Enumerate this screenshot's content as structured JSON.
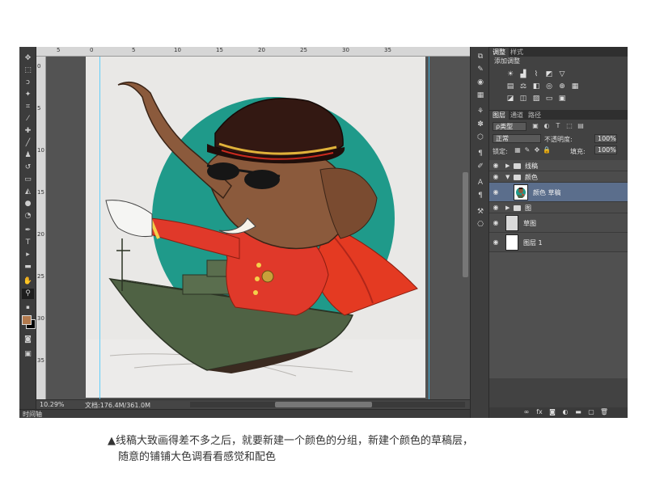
{
  "top_ruler_labels": [
    "5",
    "0",
    "5",
    "10",
    "15",
    "20",
    "25",
    "30",
    "35"
  ],
  "left_ruler_labels": [
    "0",
    "5",
    "10",
    "15",
    "20",
    "25",
    "30",
    "35"
  ],
  "status": {
    "zoom": "10.29%",
    "doc_size": "文档:176.4M/361.0M",
    "timeline_label": "时间轴"
  },
  "adjustments_panel": {
    "tabs": [
      "调整",
      "样式"
    ],
    "title": "添加调整"
  },
  "layers_panel": {
    "tabs": [
      "图层",
      "通道",
      "路径"
    ],
    "filter_kind": "ρ类型",
    "blend_mode": "正常",
    "opacity_label": "不透明度:",
    "opacity_value": "100%",
    "lock_label": "锁定:",
    "fill_label": "填充:",
    "fill_value": "100%",
    "layers": [
      {
        "name": "线稿",
        "type": "group",
        "expanded": false
      },
      {
        "name": "颜色",
        "type": "group",
        "expanded": true
      },
      {
        "name": "颜色 草稿",
        "type": "layer",
        "selected": true
      },
      {
        "name": "图",
        "type": "group",
        "expanded": false
      },
      {
        "name": "草图",
        "type": "layer"
      },
      {
        "name": "图层 1",
        "type": "layer"
      }
    ]
  },
  "colors": {
    "foreground": "#b27a4e",
    "background": "#000000",
    "teal_circle": "#1f9a8a",
    "selection": "#5b6e8c"
  },
  "caption": {
    "line1": "▲线稿大致画得差不多之后，就要新建一个颜色的分组，新建个颜色的草稿层，",
    "line2": "随意的铺铺大色调看看感觉和配色"
  }
}
